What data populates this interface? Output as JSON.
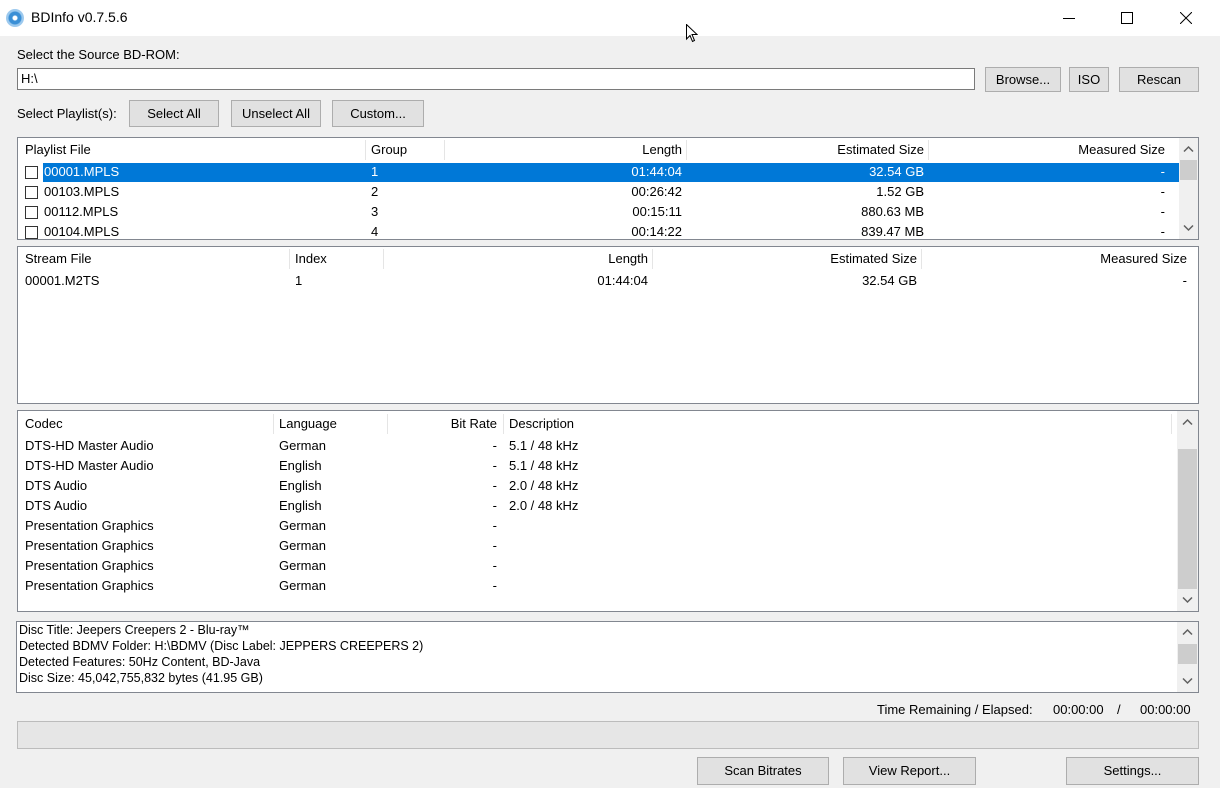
{
  "window": {
    "title": "BDInfo v0.7.5.6"
  },
  "source": {
    "label": "Select the Source BD-ROM:",
    "path": "H:\\",
    "browse": "Browse...",
    "iso": "ISO",
    "rescan": "Rescan"
  },
  "playlist_select": {
    "label": "Select Playlist(s):",
    "select_all": "Select All",
    "unselect_all": "Unselect All",
    "custom": "Custom..."
  },
  "playlists": {
    "columns": [
      "Playlist File",
      "Group",
      "Length",
      "Estimated Size",
      "Measured Size"
    ],
    "rows": [
      {
        "file": "00001.MPLS",
        "group": "1",
        "length": "01:44:04",
        "est": "32.54 GB",
        "measured": "-"
      },
      {
        "file": "00103.MPLS",
        "group": "2",
        "length": "00:26:42",
        "est": "1.52 GB",
        "measured": "-"
      },
      {
        "file": "00112.MPLS",
        "group": "3",
        "length": "00:15:11",
        "est": "880.63 MB",
        "measured": "-"
      },
      {
        "file": "00104.MPLS",
        "group": "4",
        "length": "00:14:22",
        "est": "839.47 MB",
        "measured": "-"
      }
    ]
  },
  "streams": {
    "columns": [
      "Stream File",
      "Index",
      "Length",
      "Estimated Size",
      "Measured Size"
    ],
    "rows": [
      {
        "file": "00001.M2TS",
        "index": "1",
        "length": "01:44:04",
        "est": "32.54 GB",
        "measured": "-"
      }
    ]
  },
  "codecs": {
    "columns": [
      "Codec",
      "Language",
      "Bit Rate",
      "Description"
    ],
    "rows": [
      {
        "codec": "DTS-HD Master Audio",
        "lang": "German",
        "bitrate": "-",
        "desc": "5.1 / 48 kHz"
      },
      {
        "codec": "DTS-HD Master Audio",
        "lang": "English",
        "bitrate": "-",
        "desc": "5.1 / 48 kHz"
      },
      {
        "codec": "DTS Audio",
        "lang": "English",
        "bitrate": "-",
        "desc": "2.0 / 48 kHz"
      },
      {
        "codec": "DTS Audio",
        "lang": "English",
        "bitrate": "-",
        "desc": "2.0 / 48 kHz"
      },
      {
        "codec": "Presentation Graphics",
        "lang": "German",
        "bitrate": "-",
        "desc": ""
      },
      {
        "codec": "Presentation Graphics",
        "lang": "German",
        "bitrate": "-",
        "desc": ""
      },
      {
        "codec": "Presentation Graphics",
        "lang": "German",
        "bitrate": "-",
        "desc": ""
      },
      {
        "codec": "Presentation Graphics",
        "lang": "German",
        "bitrate": "-",
        "desc": ""
      }
    ]
  },
  "info": {
    "lines": [
      "Disc Title: Jeepers Creepers 2 - Blu-ray™",
      "Detected BDMV Folder: H:\\BDMV (Disc Label: JEPPERS CREEPERS 2)",
      "Detected Features: 50Hz Content, BD-Java",
      "Disc Size: 45,042,755,832 bytes (41.95 GB)"
    ]
  },
  "timer": {
    "label": "Time Remaining / Elapsed:",
    "remaining": "00:00:00",
    "sep": "/",
    "elapsed": "00:00:00"
  },
  "progress_fraction": 0,
  "actions": {
    "scan": "Scan Bitrates",
    "report": "View Report...",
    "settings": "Settings..."
  },
  "colors": {
    "selection": "#0078d7",
    "window_bg": "#f0f0f0"
  }
}
